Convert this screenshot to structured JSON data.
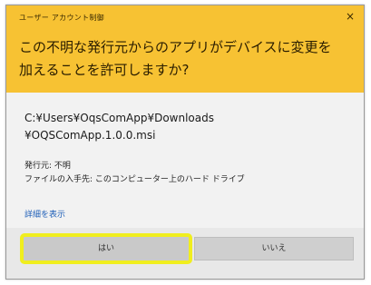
{
  "dialog": {
    "caption": "ユーザー アカウント制御",
    "close_glyph": "×",
    "question_line1": "この不明な発行元からのアプリがデバイスに変更を",
    "question_line2": "加えることを許可しますか?",
    "file_path_line1": "C:¥Users¥OqsComApp¥Downloads",
    "file_path_line2": "¥OQSComApp.1.0.0.msi",
    "publisher_line": "発行元: 不明",
    "file_origin_line": "ファイルの入手先: このコンピューター上のハード ドライブ",
    "details_link": "詳細を表示",
    "yes_button": "はい",
    "no_button": "いいえ"
  },
  "colors": {
    "header": "#f7c233",
    "highlight": "#f0ee1e",
    "link": "#1f5fb8"
  }
}
